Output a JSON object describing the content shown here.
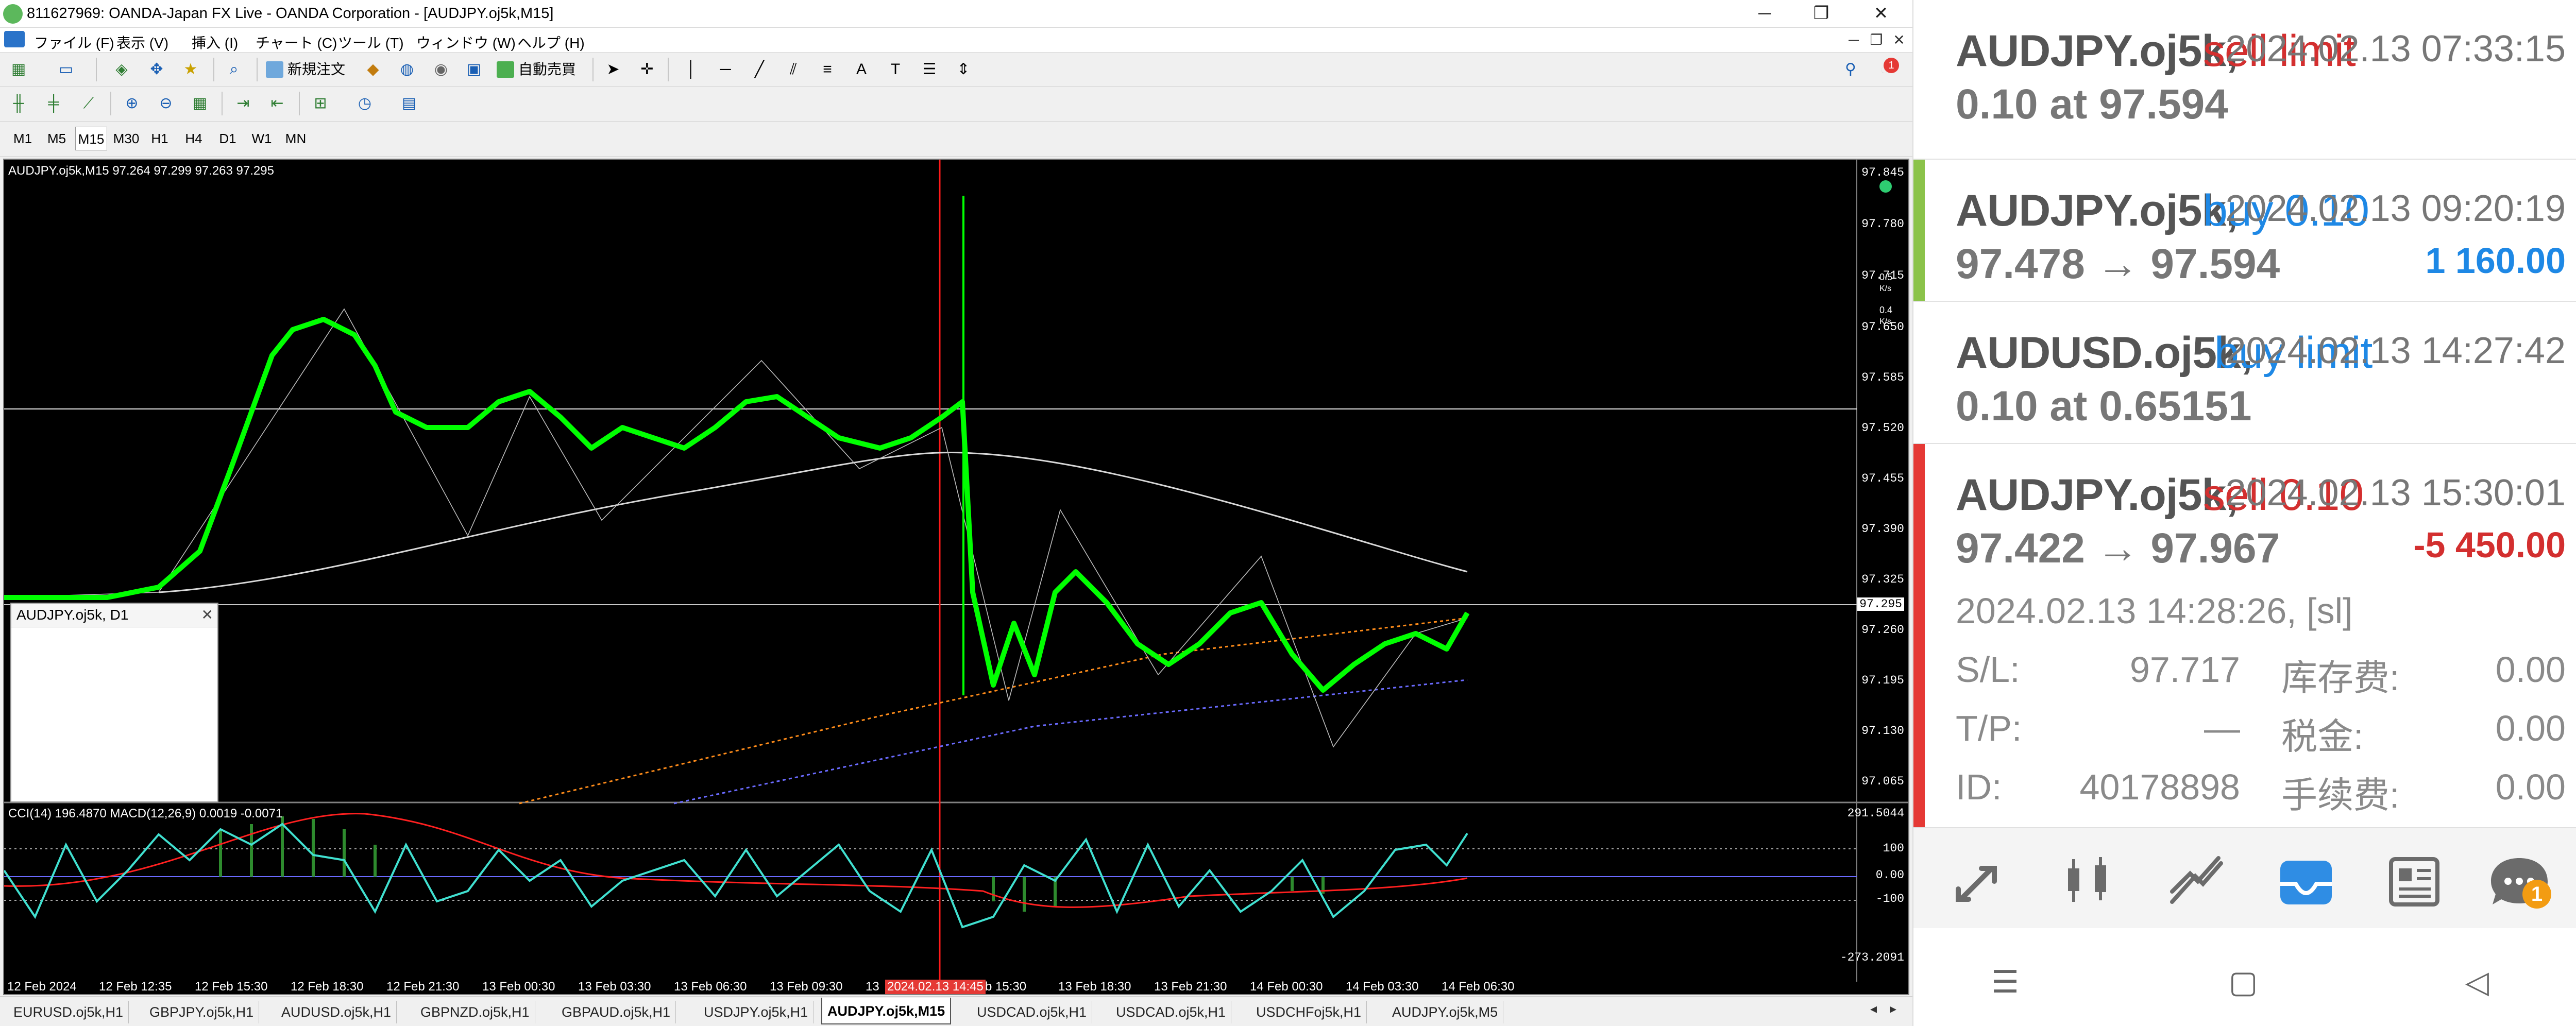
{
  "window": {
    "title": "811627969: OANDA-Japan FX Live - OANDA Corporation - [AUDJPY.oj5k,M15]",
    "minimize": "─",
    "restore": "❐",
    "close": "✕"
  },
  "menu": {
    "items": [
      "ファイル (F)",
      "表示 (V)",
      "挿入 (I)",
      "チャート (C)",
      "ツール (T)",
      "ウィンドウ (W)",
      "ヘルプ (H)"
    ],
    "mdi_minimize": "─",
    "mdi_restore": "❐",
    "mdi_close": "✕"
  },
  "toolbar": {
    "new_order": "新規注文",
    "auto_trading": "自動売買",
    "notification_count": "1"
  },
  "timeframes": [
    "M1",
    "M5",
    "M15",
    "M30",
    "H1",
    "H4",
    "D1",
    "W1",
    "MN"
  ],
  "active_timeframe": "M15",
  "chart": {
    "header": "AUDJPY.oj5k,M15  97.264 97.299 97.263 97.295",
    "price_ticks": [
      "97.845",
      "97.780",
      "97.715",
      "97.650",
      "97.585",
      "97.520",
      "97.455",
      "97.390",
      "97.325",
      "97.295",
      "97.260",
      "97.195",
      "97.130",
      "97.065"
    ],
    "current_price": "97.295",
    "osc_header": "CCI(14) 196.4870  MACD(12,26,9) 0.0019 -0.0071",
    "osc_ticks": [
      "291.5044",
      "100",
      "0.00",
      "-100",
      "-273.2091"
    ],
    "time_ticks": [
      "12 Feb 2024",
      "12 Feb 12:35",
      "12 Feb 15:30",
      "12 Feb 18:30",
      "12 Feb 21:30",
      "13 Feb 00:30",
      "13 Feb 03:30",
      "13 Feb 06:30",
      "13 Feb 09:30",
      "13",
      "2024.02.13 14:45",
      "b 15:30",
      "13 Feb 18:30",
      "13 Feb 21:30",
      "14 Feb 00:30",
      "14 Feb 03:30",
      "14 Feb 06:30"
    ],
    "side_indicator": {
      "v1": "0.5",
      "v2": "K/s",
      "v3": "0.4",
      "v4": "K/s"
    },
    "colors": {
      "candle": "#00ff00",
      "vline": "#ff0000",
      "ma": "#d8d8d8",
      "cci": "#40e0d0",
      "macd_signal": "#ff2020"
    }
  },
  "mini_chart": {
    "title": "AUDJPY.oj5k, D1",
    "close": "✕"
  },
  "tabs": [
    "EURUSD.oj5k,H1",
    "GBPJPY.oj5k,H1",
    "AUDUSD.oj5k,H1",
    "GBPNZD.oj5k,H1",
    "GBPAUD.oj5k,H1",
    "USDJPY.oj5k,H1",
    "AUDJPY.oj5k,M15",
    "USDCAD.oj5k,H1",
    "USDCAD.oj5k,H1",
    "USDCHFoj5k,H1",
    "AUDJPY.oj5k,M5"
  ],
  "active_tab": "AUDJPY.oj5k,M15",
  "tab_arrows": {
    "left": "◂",
    "right": "▸"
  },
  "orders": [
    {
      "symbol": "AUDJPY.oj5k,",
      "type": "sell limit",
      "type_color": "#d32f2f",
      "date": "2024.02.13 07:33:15",
      "line2": "0.10 at 97.594",
      "profit": "",
      "stripe": ""
    },
    {
      "symbol": "AUDJPY.oj5k,",
      "type": "buy 0.10",
      "type_color": "#1e88e5",
      "date": "2024.02.13 09:20:19",
      "line2": "97.478 → 97.594",
      "profit": "1 160.00",
      "profit_color": "#1e88e5",
      "stripe": "#8bc34a"
    },
    {
      "symbol": "AUDUSD.oj5k,",
      "type": "buy limit",
      "type_color": "#1e88e5",
      "date": "2024.02.13 14:27:42",
      "line2": "0.10 at 0.65151",
      "profit": "",
      "stripe": ""
    },
    {
      "symbol": "AUDJPY.oj5k,",
      "type": "sell 0.10",
      "type_color": "#d32f2f",
      "date": "2024.02.13 15:30:01",
      "line2": "97.422 → 97.967",
      "profit": "-5 450.00",
      "profit_color": "#d32f2f",
      "stripe": "#e53935"
    }
  ],
  "order_detail": {
    "open_time": "2024.02.13 14:28:26, [sl]",
    "sl_label": "S/L:",
    "sl_value": "97.717",
    "swap_label": "库存费:",
    "swap_value": "0.00",
    "tp_label": "T/P:",
    "tp_value": "—",
    "tax_label": "税金:",
    "tax_value": "0.00",
    "id_label": "ID:",
    "id_value": "40178898",
    "fee_label": "手续费:",
    "fee_value": "0.00"
  },
  "bottom_nav": {
    "icons": [
      "trade-icon",
      "chart-candles-icon",
      "analytics-icon",
      "inbox-icon",
      "news-icon",
      "chat-icon"
    ],
    "active": "inbox-icon",
    "badge": "1"
  },
  "system_nav": {
    "menu": "☰",
    "home": "▢",
    "back": "◁"
  }
}
